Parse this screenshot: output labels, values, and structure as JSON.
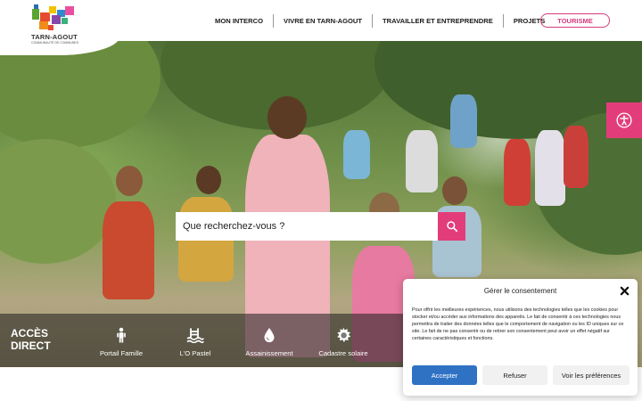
{
  "header": {
    "logo": {
      "name": "TARN-AGOUT",
      "subtitle": "COMMUNAUTÉ DE COMMUNES"
    },
    "nav": [
      {
        "label": "MON INTERCO"
      },
      {
        "label": "VIVRE EN TARN-AGOUT"
      },
      {
        "label": "TRAVAILLER ET ENTREPRENDRE"
      },
      {
        "label": "PROJETS"
      }
    ],
    "tourisme_label": "TOURISME"
  },
  "search": {
    "placeholder": "Que recherchez-vous ?",
    "icon": "search-icon"
  },
  "direct_access": {
    "title": "ACCÈS DIRECT",
    "items": [
      {
        "label": "Portail Famille",
        "icon": "family-icon"
      },
      {
        "label": "L'O Pastel",
        "icon": "swimming-icon"
      },
      {
        "label": "Assainissement",
        "icon": "water-drop-icon"
      },
      {
        "label": "Cadastre solaire",
        "icon": "sun-icon"
      }
    ]
  },
  "accessibility": {
    "icon": "accessibility-icon"
  },
  "consent": {
    "title": "Gérer le consentement",
    "text": "Pour offrir les meilleures expériences, nous utilisons des technologies telles que les cookies pour stocker et/ou accéder aux informations des appareils. Le fait de consentir à ces technologies nous permettra de traiter des données telles que le comportement de navigation ou les ID uniques sur ce site. Le fait de ne pas consentir ou de retirer son consentement peut avoir un effet négatif sur certaines caractéristiques et fonctions.",
    "accept_label": "Accepter",
    "refuse_label": "Refuser",
    "prefs_label": "Voir les préférences"
  },
  "colors": {
    "accent": "#e23d7a",
    "accept_button": "#2f72c4"
  }
}
